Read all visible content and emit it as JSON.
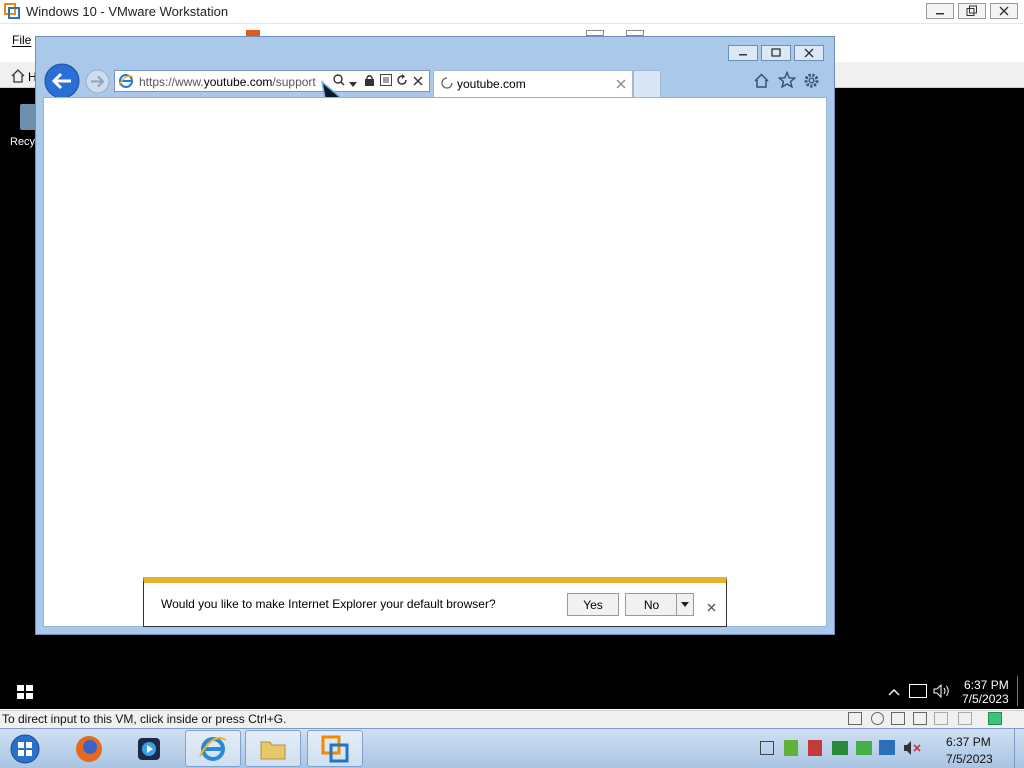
{
  "host": {
    "window_title": "Windows 10 - VMware Workstation",
    "menu_file": "File",
    "status_text": "To direct input to this VM, click inside or press Ctrl+G.",
    "time": "6:37 PM",
    "date": "7/5/2023"
  },
  "guest": {
    "desktop_icon_label": "Recy",
    "time": "6:37 PM",
    "date": "7/5/2023"
  },
  "browser": {
    "url": "https://www.youtube.com/support",
    "url_prefix": "https://www.",
    "url_domain": "youtube.com",
    "url_path": "/support",
    "tab_title": "youtube.com",
    "notification": {
      "message": "Would you like to make Internet Explorer your default browser?",
      "yes_label": "Yes",
      "no_label": "No"
    }
  },
  "colors": {
    "ie_frame": "#a9c8ea",
    "notify_accent": "#e9b22a",
    "guest_desktop": "#000000"
  }
}
